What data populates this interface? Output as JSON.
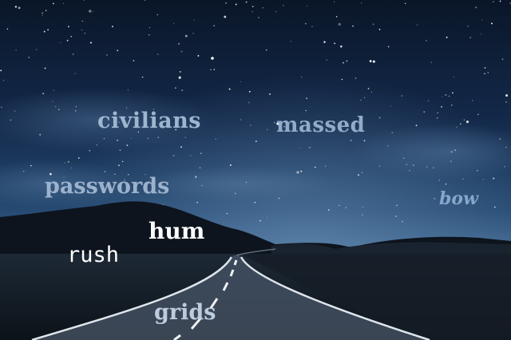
{
  "image": {
    "description_words": [
      "civilians",
      "massed",
      "passwords",
      "bow",
      "hum",
      "rush",
      "grids"
    ]
  },
  "overlay_words": {
    "civilians": "civilians",
    "massed": "massed",
    "passwords": "passwords",
    "bow": "bow",
    "hum": "hum",
    "rush": "rush",
    "grids": "grids"
  },
  "colors": {
    "sky_top": "#0c1a30",
    "sky_mid": "#1c3a5c",
    "horizon_glow": "#4f7398",
    "ground": "#141c26",
    "road": "#2a3544",
    "road_line": "#e8ecf0"
  }
}
